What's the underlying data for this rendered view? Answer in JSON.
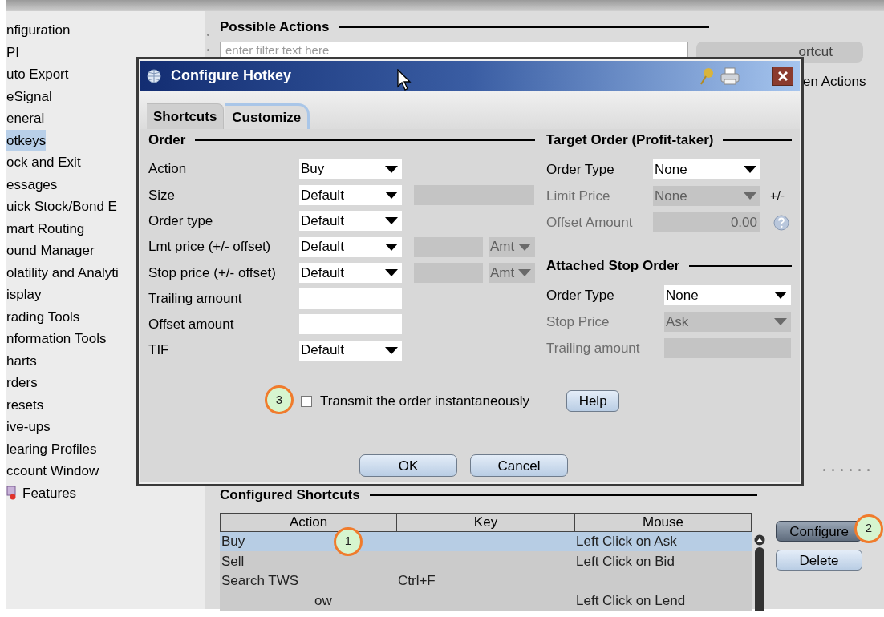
{
  "sidebar": {
    "items": [
      {
        "label": "nfiguration",
        "selected": false,
        "kind": "plain"
      },
      {
        "label": "PI",
        "selected": false,
        "kind": "plain"
      },
      {
        "label": "uto Export",
        "selected": false,
        "kind": "plain"
      },
      {
        "label": "eSignal",
        "selected": false,
        "kind": "plain"
      },
      {
        "label": "eneral",
        "selected": false,
        "kind": "plain"
      },
      {
        "label": "otkeys",
        "selected": true,
        "kind": "plain"
      },
      {
        "label": "ock and Exit",
        "selected": false,
        "kind": "plain"
      },
      {
        "label": "essages",
        "selected": false,
        "kind": "plain"
      },
      {
        "label": "uick Stock/Bond E",
        "selected": false,
        "kind": "plain"
      },
      {
        "label": "mart Routing",
        "selected": false,
        "kind": "plain"
      },
      {
        "label": "ound Manager",
        "selected": false,
        "kind": "plain"
      },
      {
        "label": "olatility and Analyti",
        "selected": false,
        "kind": "plain"
      },
      {
        "label": "isplay",
        "selected": false,
        "kind": "plain"
      },
      {
        "label": "rading Tools",
        "selected": false,
        "kind": "plain"
      },
      {
        "label": "nformation Tools",
        "selected": false,
        "kind": "plain"
      },
      {
        "label": "harts",
        "selected": false,
        "kind": "plain"
      },
      {
        "label": "rders",
        "selected": false,
        "kind": "plain"
      },
      {
        "label": "resets",
        "selected": false,
        "kind": "plain"
      },
      {
        "label": "ive-ups",
        "selected": false,
        "kind": "plain"
      },
      {
        "label": "learing Profiles",
        "selected": false,
        "kind": "plain"
      },
      {
        "label": "ccount Window",
        "selected": false,
        "kind": "plain"
      },
      {
        "label": "Features",
        "selected": false,
        "kind": "feature"
      }
    ]
  },
  "possible_actions": {
    "title": "Possible Actions",
    "filter": {
      "placeholder": "enter filter text here"
    },
    "button": "ortcut",
    "option": "en Actions"
  },
  "dialog": {
    "title": "Configure Hotkey",
    "tabs": [
      {
        "label": "Shortcuts",
        "selected": false
      },
      {
        "label": "Customize",
        "selected": true
      }
    ],
    "order": {
      "title": "Order",
      "rows": [
        {
          "label": "Action",
          "control": {
            "kind": "dropdown",
            "value": "Buy",
            "disabled": false
          }
        },
        {
          "label": "Size",
          "control": {
            "kind": "dropdown",
            "value": "Default",
            "disabled": false
          },
          "extras": [
            {
              "kind": "wide-field",
              "disabled": true
            }
          ]
        },
        {
          "label": "Order type",
          "control": {
            "kind": "dropdown",
            "value": "Default",
            "disabled": false
          }
        },
        {
          "label": "Lmt price (+/- offset)",
          "control": {
            "kind": "dropdown",
            "value": "Default",
            "disabled": false
          },
          "extras": [
            {
              "kind": "short-field",
              "disabled": true
            },
            {
              "kind": "unit-dropdown",
              "value": "Amt",
              "disabled": true
            }
          ]
        },
        {
          "label": "Stop price (+/- offset)",
          "control": {
            "kind": "dropdown",
            "value": "Default",
            "disabled": false
          },
          "extras": [
            {
              "kind": "short-field",
              "disabled": true
            },
            {
              "kind": "unit-dropdown",
              "value": "Amt",
              "disabled": true
            }
          ]
        },
        {
          "label": "Trailing amount",
          "control": {
            "kind": "field",
            "disabled": false
          }
        },
        {
          "label": "Offset amount",
          "control": {
            "kind": "field",
            "disabled": false
          }
        },
        {
          "label": "TIF",
          "control": {
            "kind": "dropdown",
            "value": "Default",
            "disabled": false
          }
        }
      ]
    },
    "target_order": {
      "title": "Target Order (Profit-taker)",
      "rows": [
        {
          "label": "Order Type",
          "disabled": false,
          "control": {
            "kind": "dropdown",
            "value": "None"
          }
        },
        {
          "label": "Limit Price",
          "disabled": true,
          "control": {
            "kind": "dropdown",
            "value": "None"
          },
          "suffix": {
            "kind": "text",
            "text": "+/-"
          }
        },
        {
          "label": "Offset Amount",
          "disabled": true,
          "control": {
            "kind": "field",
            "value": "0.00"
          },
          "suffix": {
            "kind": "help-icon"
          }
        }
      ]
    },
    "stop_order": {
      "title": "Attached Stop Order",
      "rows": [
        {
          "label": "Order Type",
          "disabled": false,
          "control": {
            "kind": "dropdown",
            "value": "None"
          }
        },
        {
          "label": "Stop Price",
          "disabled": true,
          "control": {
            "kind": "dropdown",
            "value": "Ask"
          }
        },
        {
          "label": "Trailing amount",
          "disabled": true,
          "control": {
            "kind": "field"
          }
        }
      ]
    },
    "transmit": {
      "label": "Transmit the order instantaneously",
      "checked": false,
      "callout": "3"
    },
    "help_button": "Help",
    "buttons": [
      "OK",
      "Cancel"
    ]
  },
  "configured_shortcuts": {
    "title": "Configured Shortcuts",
    "columns": [
      "Action",
      "Key",
      "Mouse"
    ],
    "rows": [
      {
        "action": "Buy",
        "mouse": "Left Click on Ask",
        "selected": true,
        "callout": "1"
      },
      {
        "action": "Sell",
        "mouse": "Left Click on Bid",
        "selected": false
      },
      {
        "action": "Search TWS",
        "key": "Ctrl+F",
        "selected": false
      },
      {
        "action": "ow",
        "mouse": "Left Click on Lend",
        "selected": false
      }
    ],
    "buttons": [
      {
        "label": "Configure",
        "selected": true,
        "callout": "2"
      },
      {
        "label": "Delete",
        "selected": false
      }
    ]
  }
}
